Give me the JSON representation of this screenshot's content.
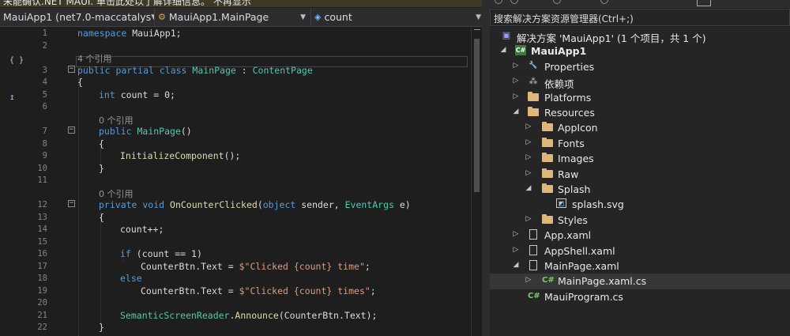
{
  "info_bar": {
    "text": "未能确认.NET MAUI. 单击此处以了解详细信息。  不再显示"
  },
  "nav_bar": {
    "project": "MauiApp1 (net7.0-maccatalys",
    "class": "MauiApp1.MainPage",
    "member": "count"
  },
  "editor": {
    "codelens_4": "4 个引用",
    "codelens_0": "0 个引用",
    "line_numbers": [
      "1",
      "2",
      "3",
      "4",
      "5",
      "6",
      "7",
      "8",
      "9",
      "10",
      "11",
      "12",
      "13",
      "14",
      "15",
      "16",
      "17",
      "18",
      "19",
      "20",
      "21",
      "22"
    ],
    "lines": {
      "l1_kw": "namespace",
      "l1_rest": " MauiApp1;",
      "l3_kw": "public partial class",
      "l3_ty": "MainPage",
      "l3_colon": " : ",
      "l3_base": "ContentPage",
      "l4": "{",
      "l5_kw": "int",
      "l5_rest": " count = 0;",
      "l7_kw": "public",
      "l7_fn": "MainPage",
      "l7_rest": "()",
      "l8": "{",
      "l9_fn": "InitializeComponent",
      "l9_rest": "();",
      "l10": "}",
      "l12_kw": "private void",
      "l12_fn": "OnCounterClicked",
      "l12_p1": "(",
      "l12_kw2": "object",
      "l12_p2": " sender, ",
      "l12_ty": "EventArgs",
      "l12_p3": " e)",
      "l13": "{",
      "l14": "count++;",
      "l16_kw": "if",
      "l16_rest": " (count == 1)",
      "l17_a": "CounterBtn.Text = ",
      "l17_str": "$\"Clicked {count} time\"",
      "l17_end": ";",
      "l18_kw": "else",
      "l19_a": "CounterBtn.Text = ",
      "l19_str": "$\"Clicked {count} times\"",
      "l19_end": ";",
      "l21_ty": "SemanticScreenReader",
      "l21_dot": ".",
      "l21_fn": "Announce",
      "l21_rest": "(CounterBtn.Text);",
      "l22": "}"
    }
  },
  "solution_explorer": {
    "search_placeholder": "搜索解决方案资源管理器(Ctrl+;)",
    "items": [
      {
        "label": "解决方案 'MauiApp1' (1 个项目，共 1 个)"
      },
      {
        "label": "MauiApp1"
      },
      {
        "label": "Properties"
      },
      {
        "label": "依赖项"
      },
      {
        "label": "Platforms"
      },
      {
        "label": "Resources"
      },
      {
        "label": "AppIcon"
      },
      {
        "label": "Fonts"
      },
      {
        "label": "Images"
      },
      {
        "label": "Raw"
      },
      {
        "label": "Splash"
      },
      {
        "label": "splash.svg"
      },
      {
        "label": "Styles"
      },
      {
        "label": "App.xaml"
      },
      {
        "label": "AppShell.xaml"
      },
      {
        "label": "MainPage.xaml"
      },
      {
        "label": "MainPage.xaml.cs"
      },
      {
        "label": "MauiProgram.cs"
      }
    ]
  },
  "colors": {
    "keyword": "#569cd6",
    "type": "#4ec9b0",
    "method": "#dcdcaa",
    "string": "#d69d85",
    "background": "#1e1e1e",
    "panel": "#252526"
  }
}
